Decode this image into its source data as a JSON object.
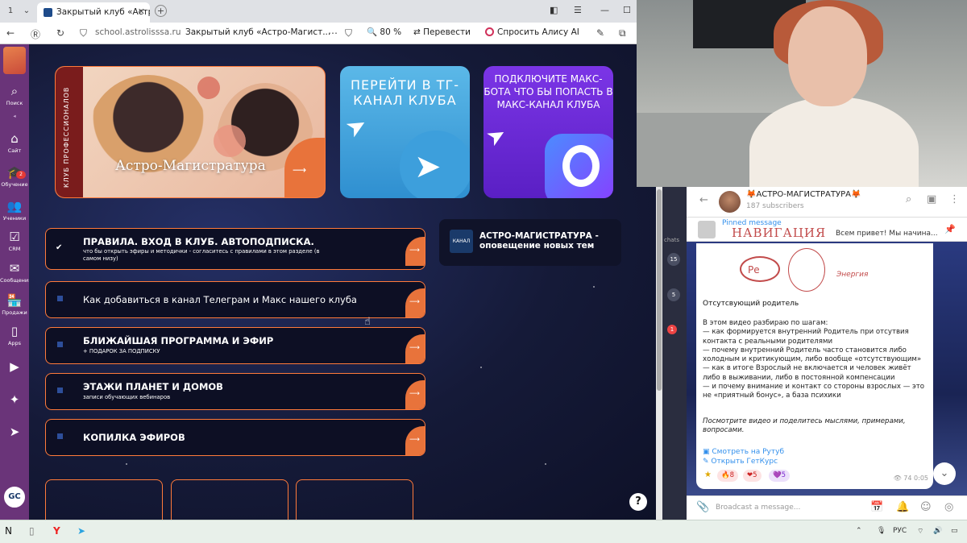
{
  "browser": {
    "tab_title": "Закрытый клуб «Астро",
    "url": "school.astrolisssa.ru",
    "page_title": "Закрытый клуб «Астро-Магист...",
    "zoom": "80 %",
    "translate": "Перевести",
    "alice": "Спросить Алису AI"
  },
  "sidebar": {
    "items": [
      {
        "label": "Поиск",
        "icon": "search-icon"
      },
      {
        "label": "Сайт",
        "icon": "home-icon"
      },
      {
        "label": "Обучение",
        "icon": "graduation-cap-icon",
        "badge": "2"
      },
      {
        "label": "Ученики",
        "icon": "students-icon"
      },
      {
        "label": "CRM",
        "icon": "checkbox-icon"
      },
      {
        "label": "Сообщения",
        "icon": "mail-icon"
      },
      {
        "label": "Продажи",
        "icon": "store-icon"
      },
      {
        "label": "Apps",
        "icon": "phone-icon"
      }
    ],
    "gc_logo": "GC"
  },
  "banners": {
    "b1_strip": "КЛУБ ПРОФЕССИОНАЛОВ",
    "b1_title": "Астро-Магистратура",
    "b2_title": "ПЕРЕЙТИ В ТГ-КАНАЛ КЛУБА",
    "b3_title": "ПОДКЛЮЧИТЕ МАКС-БОТА ЧТО БЫ ПОПАСТЬ В МАКС-КАНАЛ КЛУБА",
    "arrow": "⟶"
  },
  "menu": [
    {
      "label": "ПРАВИЛА. ВХОД В КЛУБ. АВТОПОДПИСКА.",
      "sub": "что бы открыть эфиры и методички - согласитесь с правилами в этом разделе (в самом низу)"
    },
    {
      "label": "Как добавиться в канал Телеграм и Макс нашего клуба",
      "sub": ""
    },
    {
      "label": "БЛИЖАЙШАЯ ПРОГРАММА И ЭФИР",
      "sub": "+ ПОДАРОК ЗА ПОДПИСКУ"
    },
    {
      "label": "ЭТАЖИ ПЛАНЕТ И ДОМОВ",
      "sub": "записи обучающих вебинаров"
    },
    {
      "label": "КОПИЛКА ЭФИРОВ",
      "sub": ""
    }
  ],
  "channel_card": {
    "logo": "КАНАЛ",
    "title": "АСТРО-МАГИСТРАТУРА - оповещение новых тем"
  },
  "help": "?",
  "telegram": {
    "channel_name": "🦊АСТРО-МАГИСТРАТУРА🦊",
    "subscribers": "187 subscribers",
    "chats_label": "chats",
    "badges": [
      "15",
      "5",
      "1"
    ],
    "pinned_label": "Pinned message",
    "pinned_nav": "НАВИГАЦИЯ",
    "pinned_preview": "Всем привет! Мы начина...",
    "drawing_label": "Ре",
    "drawing_note": "Энергия",
    "message_heading": "Отсутсвующий родитель",
    "message_body": "В этом видео разбираю по шагам:\n— как формируется внутренний Родитель при отсутвия контакта с реальными родителями\n— почему внутренний Родитель часто становится либо холодным и критикующим, либо вообще «отсутствующим»\n— как в итоге Взрослый не включается и человек живёт либо в выживании, либо в постоянной компенсации\n— и почему внимание и контакт со стороны взрослых — это не «приятный бонус», а база психики",
    "message_cta": "Посмотрите видео и поделитесь мыслями, примерами, вопросами.",
    "link1": "Смотреть на Рутуб",
    "link2": "Открыть ГетКурс",
    "reactions": [
      "8",
      "5",
      "5"
    ],
    "views": "74",
    "time": "0:05",
    "input_placeholder": "Broadcast a message..."
  },
  "taskbar": {
    "lang": "РУС"
  }
}
